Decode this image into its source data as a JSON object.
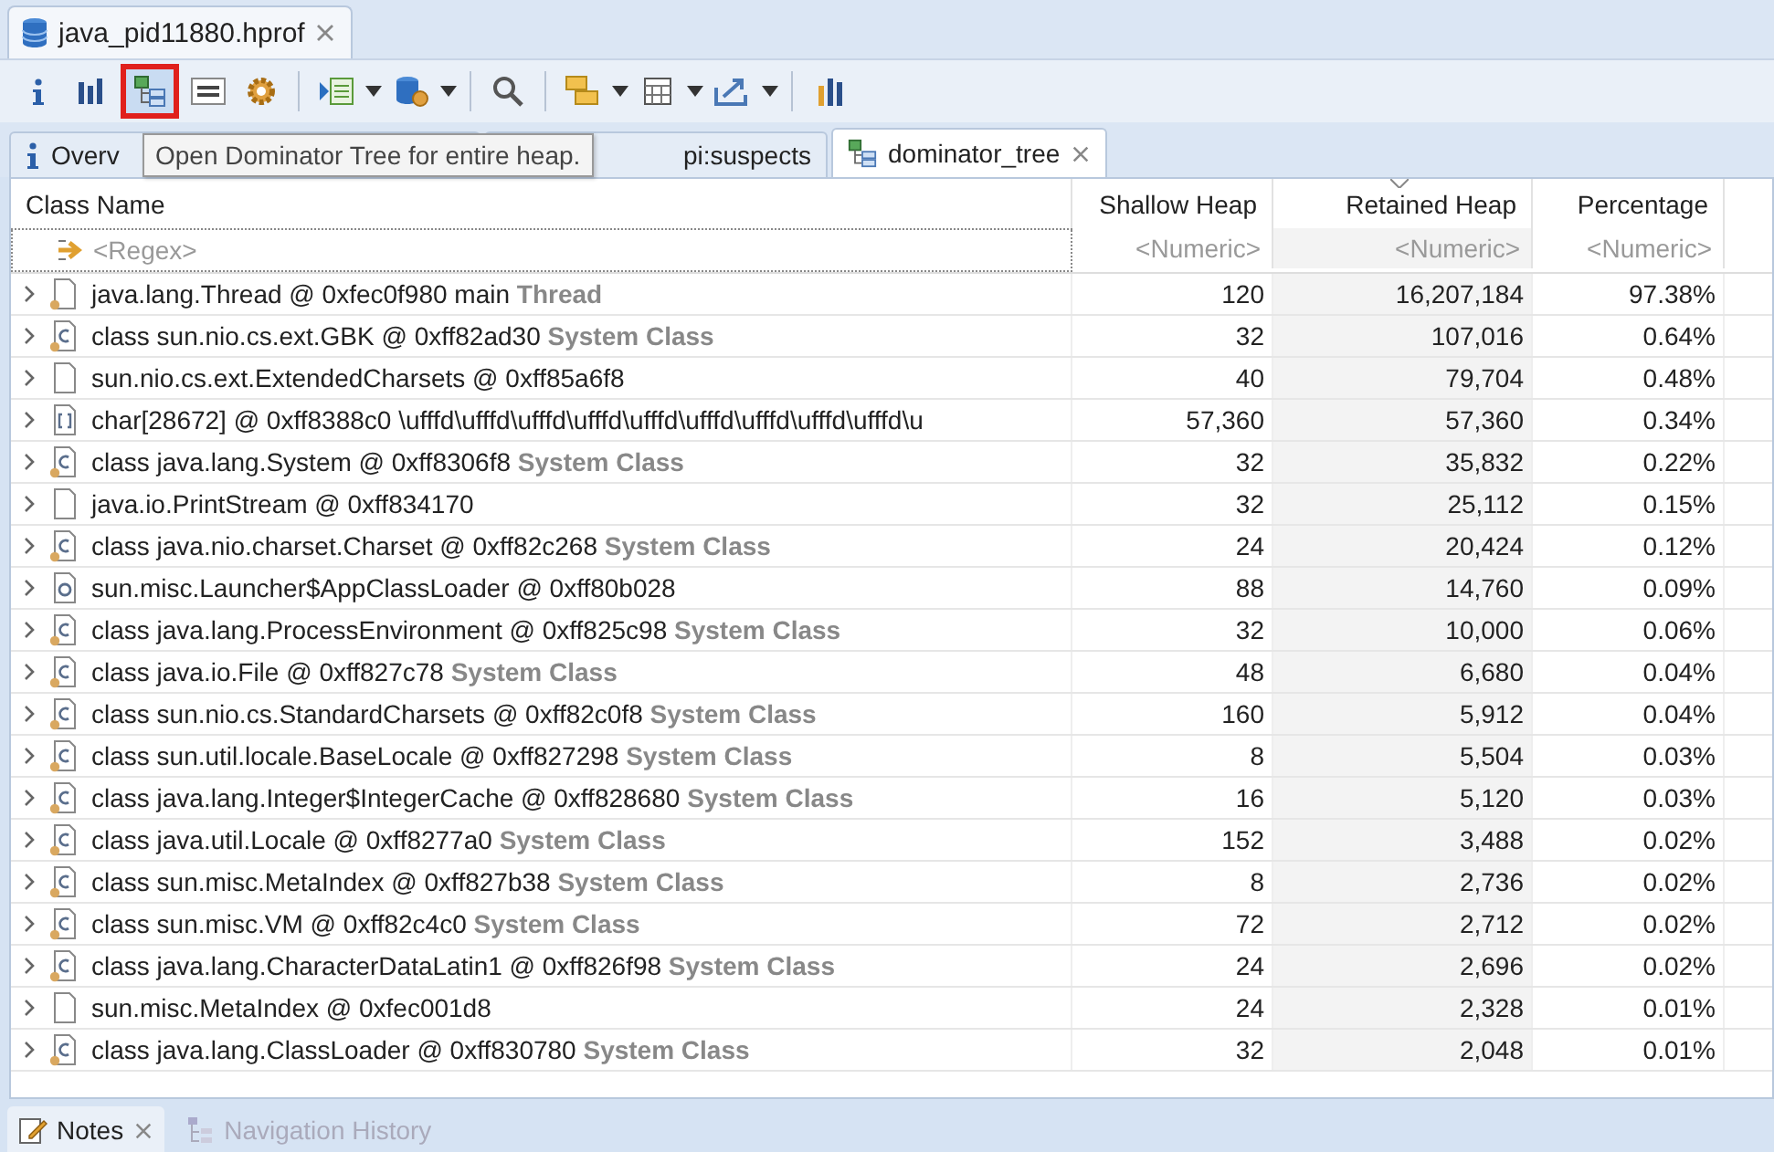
{
  "editor_tab": {
    "title": "java_pid11880.hprof"
  },
  "toolbar": [
    {
      "kind": "info",
      "highlighted": false,
      "dropdown": false
    },
    {
      "kind": "histogram",
      "highlighted": false,
      "dropdown": false
    },
    {
      "kind": "dominator",
      "highlighted": true,
      "dropdown": false
    },
    {
      "kind": "oql",
      "highlighted": false,
      "dropdown": false
    },
    {
      "kind": "gear",
      "highlighted": false,
      "dropdown": false
    },
    {
      "kind": "separator"
    },
    {
      "kind": "report",
      "highlighted": false,
      "dropdown": true
    },
    {
      "kind": "database",
      "highlighted": false,
      "dropdown": true
    },
    {
      "kind": "separator"
    },
    {
      "kind": "search",
      "highlighted": false,
      "dropdown": false
    },
    {
      "kind": "separator"
    },
    {
      "kind": "group",
      "highlighted": false,
      "dropdown": true
    },
    {
      "kind": "calculator",
      "highlighted": false,
      "dropdown": true
    },
    {
      "kind": "export",
      "highlighted": false,
      "dropdown": true
    },
    {
      "kind": "separator"
    },
    {
      "kind": "chart",
      "highlighted": false,
      "dropdown": false
    }
  ],
  "tooltip": "Open Dominator Tree for entire heap.",
  "tabs": [
    {
      "label": "Overv",
      "kind": "info",
      "selected": false
    },
    {
      "label": "pi:suspects",
      "kind": "none",
      "selected": false
    },
    {
      "label": "dominator_tree",
      "kind": "dominator",
      "selected": true
    }
  ],
  "table": {
    "columns": [
      {
        "label": "Class Name",
        "filter": "<Regex>",
        "sorted": false
      },
      {
        "label": "Shallow Heap",
        "filter": "<Numeric>",
        "sorted": false
      },
      {
        "label": "Retained Heap",
        "filter": "<Numeric>",
        "sorted": true
      },
      {
        "label": "Percentage",
        "filter": "<Numeric>",
        "sorted": false
      }
    ],
    "rows": [
      {
        "kind": "thread",
        "name": "java.lang.Thread @ 0xfec0f980  main",
        "tag": "Thread",
        "shallow": "120",
        "retained": "16,207,184",
        "percentage": "97.38%"
      },
      {
        "kind": "class",
        "name": "class sun.nio.cs.ext.GBK @ 0xff82ad30",
        "tag": "System Class",
        "shallow": "32",
        "retained": "107,016",
        "percentage": "0.64%"
      },
      {
        "kind": "object",
        "name": "sun.nio.cs.ext.ExtendedCharsets @ 0xff85a6f8",
        "tag": "",
        "shallow": "40",
        "retained": "79,704",
        "percentage": "0.48%"
      },
      {
        "kind": "array",
        "name": "char[28672] @ 0xff8388c0  \\ufffd\\ufffd\\ufffd\\ufffd\\ufffd\\ufffd\\ufffd\\ufffd\\ufffd\\u",
        "tag": "",
        "shallow": "57,360",
        "retained": "57,360",
        "percentage": "0.34%"
      },
      {
        "kind": "class",
        "name": "class java.lang.System @ 0xff8306f8",
        "tag": "System Class",
        "shallow": "32",
        "retained": "35,832",
        "percentage": "0.22%"
      },
      {
        "kind": "object",
        "name": "java.io.PrintStream @ 0xff834170",
        "tag": "",
        "shallow": "32",
        "retained": "25,112",
        "percentage": "0.15%"
      },
      {
        "kind": "class",
        "name": "class java.nio.charset.Charset @ 0xff82c268",
        "tag": "System Class",
        "shallow": "24",
        "retained": "20,424",
        "percentage": "0.12%"
      },
      {
        "kind": "classloader",
        "name": "sun.misc.Launcher$AppClassLoader @ 0xff80b028",
        "tag": "",
        "shallow": "88",
        "retained": "14,760",
        "percentage": "0.09%"
      },
      {
        "kind": "class",
        "name": "class java.lang.ProcessEnvironment @ 0xff825c98",
        "tag": "System Class",
        "shallow": "32",
        "retained": "10,000",
        "percentage": "0.06%"
      },
      {
        "kind": "class",
        "name": "class java.io.File @ 0xff827c78",
        "tag": "System Class",
        "shallow": "48",
        "retained": "6,680",
        "percentage": "0.04%"
      },
      {
        "kind": "class",
        "name": "class sun.nio.cs.StandardCharsets @ 0xff82c0f8",
        "tag": "System Class",
        "shallow": "160",
        "retained": "5,912",
        "percentage": "0.04%"
      },
      {
        "kind": "class",
        "name": "class sun.util.locale.BaseLocale @ 0xff827298",
        "tag": "System Class",
        "shallow": "8",
        "retained": "5,504",
        "percentage": "0.03%"
      },
      {
        "kind": "class",
        "name": "class java.lang.Integer$IntegerCache @ 0xff828680",
        "tag": "System Class",
        "shallow": "16",
        "retained": "5,120",
        "percentage": "0.03%"
      },
      {
        "kind": "class",
        "name": "class java.util.Locale @ 0xff8277a0",
        "tag": "System Class",
        "shallow": "152",
        "retained": "3,488",
        "percentage": "0.02%"
      },
      {
        "kind": "class",
        "name": "class sun.misc.MetaIndex @ 0xff827b38",
        "tag": "System Class",
        "shallow": "8",
        "retained": "2,736",
        "percentage": "0.02%"
      },
      {
        "kind": "class",
        "name": "class sun.misc.VM @ 0xff82c4c0",
        "tag": "System Class",
        "shallow": "72",
        "retained": "2,712",
        "percentage": "0.02%"
      },
      {
        "kind": "class",
        "name": "class java.lang.CharacterDataLatin1 @ 0xff826f98",
        "tag": "System Class",
        "shallow": "24",
        "retained": "2,696",
        "percentage": "0.02%"
      },
      {
        "kind": "object",
        "name": "sun.misc.MetaIndex @ 0xfec001d8",
        "tag": "",
        "shallow": "24",
        "retained": "2,328",
        "percentage": "0.01%"
      },
      {
        "kind": "class",
        "name": "class java.lang.ClassLoader @ 0xff830780",
        "tag": "System Class",
        "shallow": "32",
        "retained": "2,048",
        "percentage": "0.01%"
      }
    ]
  },
  "bottom_tabs": [
    {
      "label": "Notes",
      "kind": "notes",
      "selected": true
    },
    {
      "label": "Navigation History",
      "kind": "history",
      "selected": false
    }
  ]
}
